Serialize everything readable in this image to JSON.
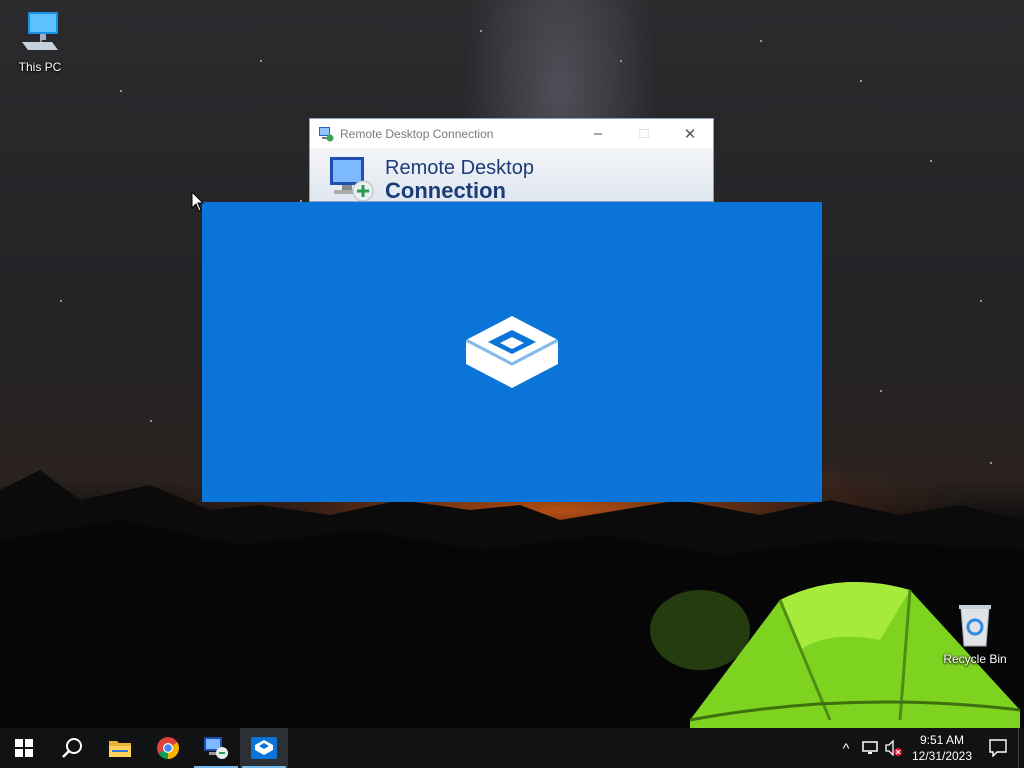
{
  "desktop": {
    "icons": [
      {
        "label": "This PC",
        "icon": "this-pc-icon"
      },
      {
        "label": "Recycle Bin",
        "icon": "recycle-bin-icon"
      }
    ]
  },
  "rdc_window": {
    "title": "Remote Desktop Connection",
    "banner_line1": "Remote Desktop",
    "banner_line2": "Connection",
    "controls": {
      "minimize": "–",
      "maximize": "□",
      "close": "✕"
    }
  },
  "sandbox_splash": {
    "icon": "windows-sandbox-icon",
    "background": "#0a74d9"
  },
  "taskbar": {
    "items": [
      {
        "name": "start",
        "icon": "windows-start-icon"
      },
      {
        "name": "search",
        "icon": "search-icon"
      },
      {
        "name": "file-explorer",
        "icon": "folder-icon"
      },
      {
        "name": "chrome",
        "icon": "chrome-icon"
      },
      {
        "name": "remote-desktop",
        "icon": "remote-desktop-icon"
      },
      {
        "name": "windows-sandbox",
        "icon": "windows-sandbox-icon",
        "active": true
      }
    ],
    "tray": {
      "chevron": "^",
      "time": "9:51 AM",
      "date": "12/31/2023"
    }
  },
  "colors": {
    "accent": "#0a74d9",
    "taskbar": "#101214",
    "active_underline": "#76b9ed"
  }
}
